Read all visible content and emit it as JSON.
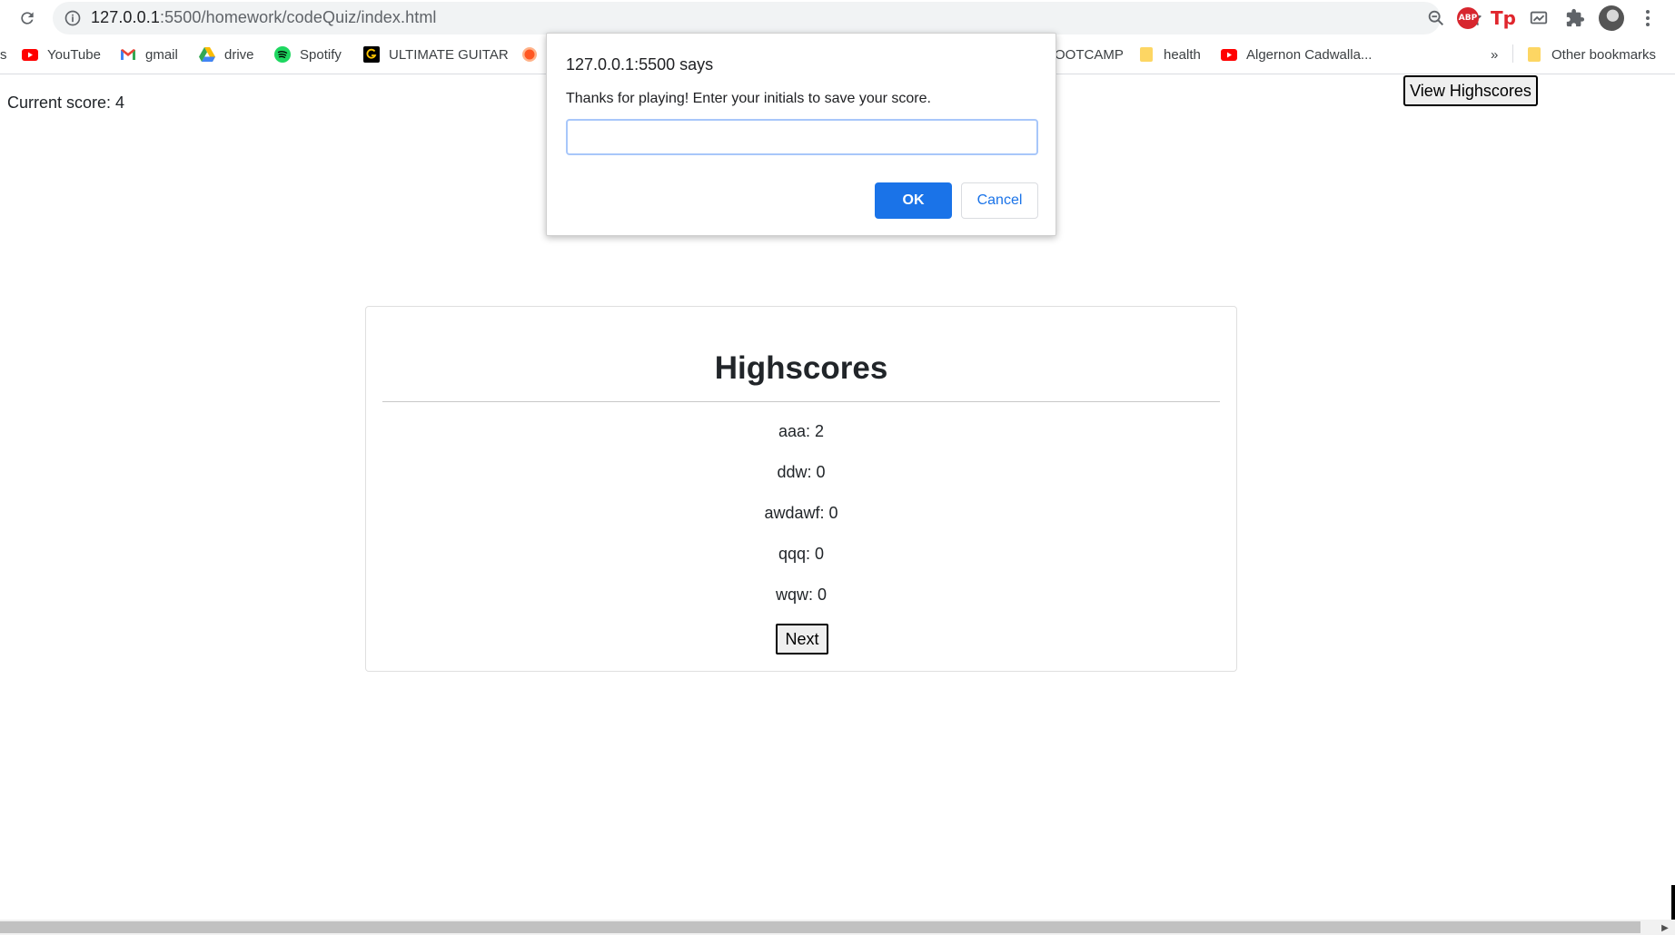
{
  "browser": {
    "url_host": "127.0.0.1",
    "url_path": ":5500/homework/codeQuiz/index.html",
    "bookmarks": [
      {
        "label": "s",
        "icon": "none"
      },
      {
        "label": "YouTube",
        "icon": "youtube-icon"
      },
      {
        "label": "gmail",
        "icon": "gmail-icon"
      },
      {
        "label": "drive",
        "icon": "google-drive-icon"
      },
      {
        "label": "Spotify",
        "icon": "spotify-icon"
      },
      {
        "label": "ULTIMATE GUITAR",
        "icon": "ultimate-guitar-icon"
      },
      {
        "label": "",
        "icon": "orange-circle-icon"
      },
      {
        "label": "OOTCAMP",
        "icon": "none"
      },
      {
        "label": "health",
        "icon": "folder-icon"
      },
      {
        "label": "Algernon Cadwalla...",
        "icon": "youtube-icon"
      },
      {
        "label": "»",
        "icon": "none"
      },
      {
        "label": "Other bookmarks",
        "icon": "folder-icon"
      }
    ]
  },
  "page": {
    "current_score": "Current score: 4",
    "view_highscores_label": "View Highscores",
    "highscores_title": "Highscores",
    "highscores": [
      "aaa: 2",
      "ddw: 0",
      "awdawf: 0",
      "qqq: 0",
      "wqw: 0"
    ],
    "next_label": "Next"
  },
  "dialog": {
    "title": "127.0.0.1:5500 says",
    "message": "Thanks for playing! Enter your initials to save your score.",
    "input_value": "",
    "ok_label": "OK",
    "cancel_label": "Cancel"
  },
  "colors": {
    "accent": "#1a73e8",
    "youtube_red": "#ff0000",
    "spotify_green": "#1ed760",
    "folder_yellow": "#fdd663"
  }
}
